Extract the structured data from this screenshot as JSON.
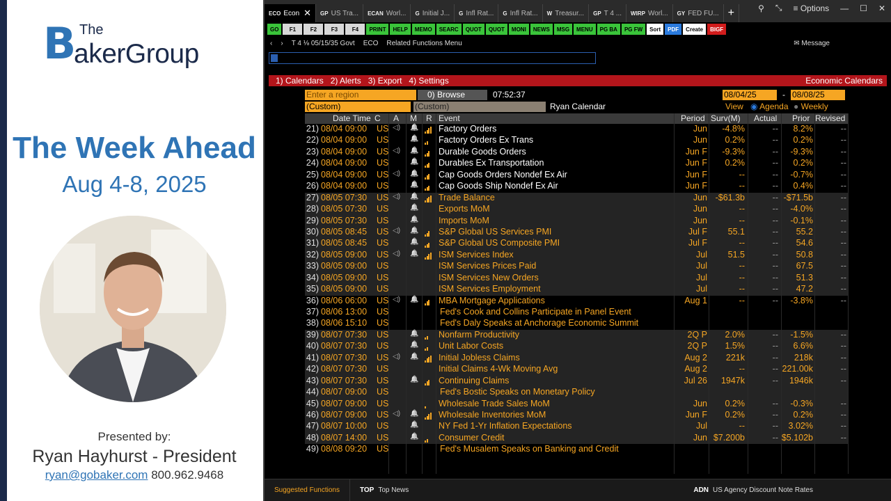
{
  "slide": {
    "logo_the": "The",
    "logo_b": "B",
    "logo_rest": "akerGroup",
    "title": "The Week Ahead",
    "dates": "Aug 4-8, 2025",
    "presented_by": "Presented by:",
    "presenter": "Ryan Hayhurst - President",
    "email": "ryan@gobaker.com",
    "phone": "800.962.9468"
  },
  "tabs": [
    {
      "code": "ECO",
      "label": "Econ",
      "active": true
    },
    {
      "code": "GP",
      "label": "US Tra..."
    },
    {
      "code": "ECAN",
      "label": "Worl..."
    },
    {
      "code": "G",
      "label": "Initial J..."
    },
    {
      "code": "G",
      "label": "Infl Rat..."
    },
    {
      "code": "G",
      "label": "Infl Rat..."
    },
    {
      "code": "W",
      "label": "Treasur..."
    },
    {
      "code": "GP",
      "label": "T 4 ..."
    },
    {
      "code": "WIRP",
      "label": "Worl..."
    },
    {
      "code": "GY",
      "label": "FED FU..."
    }
  ],
  "options_label": "Options",
  "fkeys": [
    {
      "t": "GO",
      "k": "green"
    },
    {
      "t": "F1",
      "k": "gray"
    },
    {
      "t": "F2",
      "k": "gray"
    },
    {
      "t": "F3",
      "k": "gray"
    },
    {
      "t": "F4",
      "k": "gray"
    },
    {
      "t": "PRINT",
      "k": "green"
    },
    {
      "t": "HELP",
      "k": "green"
    },
    {
      "t": "MEMO",
      "k": "green"
    },
    {
      "t": "SEARC",
      "k": "green"
    },
    {
      "t": "QUOT",
      "k": "green"
    },
    {
      "t": "QUOT",
      "k": "green"
    },
    {
      "t": "MONI",
      "k": "green"
    },
    {
      "t": "NEWS",
      "k": "green"
    },
    {
      "t": "MSG",
      "k": "green"
    },
    {
      "t": "MENU",
      "k": "green"
    },
    {
      "t": "PG BA",
      "k": "green"
    },
    {
      "t": "PG FW",
      "k": "green"
    },
    {
      "t": "Sort",
      "k": "w"
    },
    {
      "t": "PDF",
      "k": "blue"
    },
    {
      "t": "Create",
      "k": "w"
    },
    {
      "t": "BIGF",
      "k": "red"
    }
  ],
  "security": {
    "ticker": "T 4 ⅛ 05/15/35 Govt",
    "func": "ECO",
    "related": "Related Functions Menu",
    "message": "Message"
  },
  "menu": {
    "calendars": "1) Calendars",
    "alerts": "2) Alerts",
    "export": "3) Export",
    "settings": "4) Settings",
    "right": "Economic Calendars"
  },
  "controls": {
    "region_placeholder": "Enter a region",
    "browse": "0) Browse",
    "time": "07:52:37",
    "date_from": "08/04/25",
    "date_to": "08/08/25",
    "custom1": "(Custom)",
    "custom2": "(Custom)",
    "calendar_name": "Ryan Calendar",
    "view": "View",
    "agenda": "Agenda",
    "weekly": "Weekly"
  },
  "headers": {
    "datetime": "Date Time",
    "c": "C",
    "a": "A",
    "m": "M",
    "r": "R",
    "event": "Event",
    "period": "Period",
    "surv": "Surv(M)",
    "actual": "Actual",
    "prior": "Prior",
    "revised": "Revised"
  },
  "rows": [
    {
      "n": "21)",
      "dt": "08/04 09:00",
      "c": "US",
      "a": true,
      "m": true,
      "r": 4,
      "ev": "Factory Orders",
      "evc": "w",
      "p": "Jun",
      "s": "-4.8%",
      "act": "--",
      "pr": "8.2%",
      "rev": "--"
    },
    {
      "n": "22)",
      "dt": "08/04 09:00",
      "c": "US",
      "a": false,
      "m": true,
      "r": 2,
      "ev": "Factory Orders Ex Trans",
      "evc": "w",
      "p": "Jun",
      "s": "0.2%",
      "act": "--",
      "pr": "0.2%",
      "rev": "--"
    },
    {
      "n": "23)",
      "dt": "08/04 09:00",
      "c": "US",
      "a": true,
      "m": true,
      "r": 3,
      "ev": "Durable Goods Orders",
      "evc": "w",
      "p": "Jun F",
      "s": "-9.3%",
      "act": "--",
      "pr": "-9.3%",
      "rev": "--"
    },
    {
      "n": "24)",
      "dt": "08/04 09:00",
      "c": "US",
      "a": false,
      "m": true,
      "r": 3,
      "ev": "Durables Ex Transportation",
      "evc": "w",
      "p": "Jun F",
      "s": "0.2%",
      "act": "--",
      "pr": "0.2%",
      "rev": "--"
    },
    {
      "n": "25)",
      "dt": "08/04 09:00",
      "c": "US",
      "a": true,
      "m": true,
      "r": 3,
      "ev": "Cap Goods Orders Nondef Ex Air",
      "evc": "w",
      "p": "Jun F",
      "s": "--",
      "act": "--",
      "pr": "-0.7%",
      "rev": "--"
    },
    {
      "n": "26)",
      "dt": "08/04 09:00",
      "c": "US",
      "a": false,
      "m": true,
      "r": 3,
      "ev": "Cap Goods Ship Nondef Ex Air",
      "evc": "w",
      "p": "Jun F",
      "s": "--",
      "act": "--",
      "pr": "0.4%",
      "rev": "--"
    },
    {
      "n": "27)",
      "dt": "08/05 07:30",
      "c": "US",
      "a": true,
      "m": true,
      "r": 4,
      "ev": "Trade Balance",
      "evc": "o",
      "p": "Jun",
      "s": "-$61.3b",
      "act": "--",
      "pr": "-$71.5b",
      "rev": "--"
    },
    {
      "n": "28)",
      "dt": "08/05 07:30",
      "c": "US",
      "a": false,
      "m": true,
      "r": 0,
      "ev": "Exports MoM",
      "evc": "o",
      "p": "Jun",
      "s": "--",
      "act": "--",
      "pr": "-4.0%",
      "rev": "--"
    },
    {
      "n": "29)",
      "dt": "08/05 07:30",
      "c": "US",
      "a": false,
      "m": true,
      "r": 0,
      "ev": "Imports MoM",
      "evc": "o",
      "p": "Jun",
      "s": "--",
      "act": "--",
      "pr": "-0.1%",
      "rev": "--"
    },
    {
      "n": "30)",
      "dt": "08/05 08:45",
      "c": "US",
      "a": true,
      "m": true,
      "r": 3,
      "ev": "S&P Global US Services PMI",
      "evc": "o",
      "p": "Jul F",
      "s": "55.1",
      "act": "--",
      "pr": "55.2",
      "rev": "--"
    },
    {
      "n": "31)",
      "dt": "08/05 08:45",
      "c": "US",
      "a": false,
      "m": true,
      "r": 3,
      "ev": "S&P Global US Composite PMI",
      "evc": "o",
      "p": "Jul F",
      "s": "--",
      "act": "--",
      "pr": "54.6",
      "rev": "--"
    },
    {
      "n": "32)",
      "dt": "08/05 09:00",
      "c": "US",
      "a": true,
      "m": true,
      "r": 4,
      "ev": "ISM Services Index",
      "evc": "o",
      "p": "Jul",
      "s": "51.5",
      "act": "--",
      "pr": "50.8",
      "rev": "--"
    },
    {
      "n": "33)",
      "dt": "08/05 09:00",
      "c": "US",
      "a": false,
      "m": false,
      "r": 0,
      "ev": "ISM Services Prices Paid",
      "evc": "o",
      "p": "Jul",
      "s": "--",
      "act": "--",
      "pr": "67.5",
      "rev": "--"
    },
    {
      "n": "34)",
      "dt": "08/05 09:00",
      "c": "US",
      "a": false,
      "m": false,
      "r": 0,
      "ev": "ISM Services New Orders",
      "evc": "o",
      "p": "Jul",
      "s": "--",
      "act": "--",
      "pr": "51.3",
      "rev": "--"
    },
    {
      "n": "35)",
      "dt": "08/05 09:00",
      "c": "US",
      "a": false,
      "m": false,
      "r": 0,
      "ev": "ISM Services Employment",
      "evc": "o",
      "p": "Jul",
      "s": "--",
      "act": "--",
      "pr": "47.2",
      "rev": "--"
    },
    {
      "n": "36)",
      "dt": "08/06 06:00",
      "c": "US",
      "a": true,
      "m": true,
      "r": 3,
      "ev": "MBA Mortgage Applications",
      "evc": "o",
      "p": "Aug 1",
      "s": "--",
      "act": "--",
      "pr": "-3.8%",
      "rev": "--"
    },
    {
      "n": "37)",
      "dt": "08/06 13:00",
      "c": "US",
      "a": false,
      "m": false,
      "r": 0,
      "ev": "Fed's Cook and Collins Participate in Panel Event",
      "evc": "o",
      "p": "",
      "s": "",
      "act": "",
      "pr": "",
      "rev": ""
    },
    {
      "n": "38)",
      "dt": "08/06 15:10",
      "c": "US",
      "a": false,
      "m": false,
      "r": 0,
      "ev": "Fed's Daly Speaks at Anchorage Economic Summit",
      "evc": "o",
      "p": "",
      "s": "",
      "act": "",
      "pr": "",
      "rev": ""
    },
    {
      "n": "39)",
      "dt": "08/07 07:30",
      "c": "US",
      "a": false,
      "m": true,
      "r": 2,
      "ev": "Nonfarm Productivity",
      "evc": "o",
      "p": "2Q P",
      "s": "2.0%",
      "act": "--",
      "pr": "-1.5%",
      "rev": "--"
    },
    {
      "n": "40)",
      "dt": "08/07 07:30",
      "c": "US",
      "a": false,
      "m": true,
      "r": 2,
      "ev": "Unit Labor Costs",
      "evc": "o",
      "p": "2Q P",
      "s": "1.5%",
      "act": "--",
      "pr": "6.6%",
      "rev": "--"
    },
    {
      "n": "41)",
      "dt": "08/07 07:30",
      "c": "US",
      "a": true,
      "m": true,
      "r": 4,
      "ev": "Initial Jobless Claims",
      "evc": "o",
      "p": "Aug 2",
      "s": "221k",
      "act": "--",
      "pr": "218k",
      "rev": "--"
    },
    {
      "n": "42)",
      "dt": "08/07 07:30",
      "c": "US",
      "a": false,
      "m": false,
      "r": 0,
      "ev": "Initial Claims 4-Wk Moving Avg",
      "evc": "o",
      "p": "Aug 2",
      "s": "--",
      "act": "--",
      "pr": "221.00k",
      "rev": "--"
    },
    {
      "n": "43)",
      "dt": "08/07 07:30",
      "c": "US",
      "a": false,
      "m": true,
      "r": 3,
      "ev": "Continuing Claims",
      "evc": "o",
      "p": "Jul 26",
      "s": "1947k",
      "act": "--",
      "pr": "1946k",
      "rev": "--"
    },
    {
      "n": "44)",
      "dt": "08/07 09:00",
      "c": "US",
      "a": false,
      "m": false,
      "r": 0,
      "ev": "Fed's Bostic Speaks on Monetary Policy",
      "evc": "o",
      "p": "",
      "s": "",
      "act": "",
      "pr": "",
      "rev": ""
    },
    {
      "n": "45)",
      "dt": "08/07 09:00",
      "c": "US",
      "a": false,
      "m": false,
      "r": 1,
      "ev": "Wholesale Trade Sales MoM",
      "evc": "o",
      "p": "Jun",
      "s": "0.2%",
      "act": "--",
      "pr": "-0.3%",
      "rev": "--"
    },
    {
      "n": "46)",
      "dt": "08/07 09:00",
      "c": "US",
      "a": true,
      "m": true,
      "r": 4,
      "ev": "Wholesale Inventories MoM",
      "evc": "o",
      "p": "Jun F",
      "s": "0.2%",
      "act": "--",
      "pr": "0.2%",
      "rev": "--"
    },
    {
      "n": "47)",
      "dt": "08/07 10:00",
      "c": "US",
      "a": false,
      "m": true,
      "r": 0,
      "ev": "NY Fed 1-Yr Inflation Expectations",
      "evc": "o",
      "p": "Jul",
      "s": "--",
      "act": "--",
      "pr": "3.02%",
      "rev": "--"
    },
    {
      "n": "48)",
      "dt": "08/07 14:00",
      "c": "US",
      "a": false,
      "m": true,
      "r": 2,
      "ev": "Consumer Credit",
      "evc": "o",
      "p": "Jun",
      "s": "$7.200b",
      "act": "--",
      "pr": "$5.102b",
      "rev": "--"
    },
    {
      "n": "49)",
      "dt": "08/08 09:20",
      "c": "US",
      "a": false,
      "m": false,
      "r": 0,
      "ev": "Fed's Musalem Speaks on Banking and Credit",
      "evc": "o",
      "p": "",
      "s": "",
      "act": "",
      "pr": "",
      "rev": ""
    }
  ],
  "bottom": {
    "suggested": "Suggested Functions",
    "top_code": "TOP",
    "top_label": "Top News",
    "adn_code": "ADN",
    "adn_label": "US Agency Discount Note Rates"
  }
}
